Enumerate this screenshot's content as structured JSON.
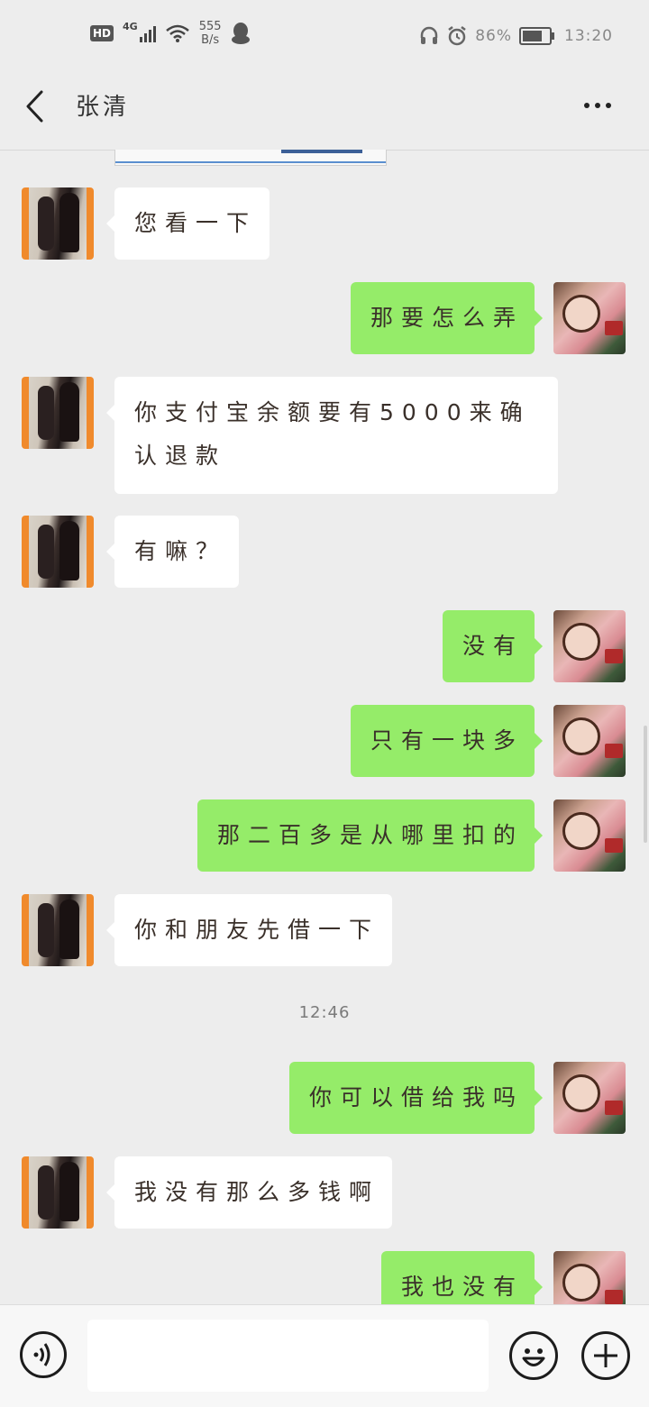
{
  "status_bar": {
    "hd": "HD",
    "signal": "4G",
    "net_speed_value": "555",
    "net_speed_unit": "B/s",
    "battery_text": "86%",
    "battery_level": 0.86,
    "time": "13:20"
  },
  "header": {
    "title": "张清"
  },
  "messages": [
    {
      "side": "left",
      "text": "您看一下"
    },
    {
      "side": "right",
      "text": "那要怎么弄"
    },
    {
      "side": "left",
      "text": "你支付宝余额要有5000来确认退款"
    },
    {
      "side": "left",
      "text": "有嘛？"
    },
    {
      "side": "right",
      "text": "没有"
    },
    {
      "side": "right",
      "text": "只有一块多"
    },
    {
      "side": "right",
      "text": "那二百多是从哪里扣的"
    },
    {
      "side": "left",
      "text": "你和朋友先借一下"
    },
    {
      "side": "right",
      "text": "你可以借给我吗"
    },
    {
      "side": "left",
      "text": "我没有那么多钱啊"
    },
    {
      "side": "right",
      "text": "我也没有"
    }
  ],
  "timestamp": "12:46",
  "input": {
    "value": "",
    "placeholder": ""
  },
  "icons": {
    "back": "back-arrow-icon",
    "more": "more-dots-icon",
    "voice": "voice-icon",
    "emoji": "emoji-icon",
    "plus": "plus-icon"
  },
  "colors": {
    "sent_bubble": "#95ec69",
    "received_bubble": "#ffffff",
    "background": "#ededed"
  }
}
